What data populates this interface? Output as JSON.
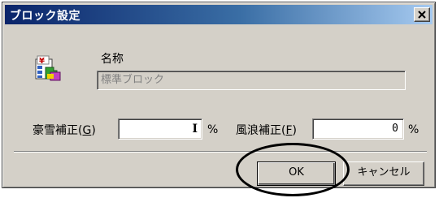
{
  "window": {
    "title": "ブロック設定",
    "close_symbol": "×"
  },
  "app_icon": {
    "name": "block-setting-icon"
  },
  "name_section": {
    "label": "名称",
    "value": "標準ブロック"
  },
  "snow": {
    "label_prefix": "豪雪補正(",
    "accel": "G",
    "label_suffix": ")",
    "value": "I",
    "unit": "%"
  },
  "wind": {
    "label_prefix": "風浪補正(",
    "accel": "F",
    "label_suffix": ")",
    "value": "0",
    "unit": "%"
  },
  "buttons": {
    "ok": "OK",
    "cancel": "キャンセル"
  },
  "colors": {
    "face": "#d4d0c8",
    "title_start": "#0a246a",
    "title_end": "#a6caf0"
  }
}
